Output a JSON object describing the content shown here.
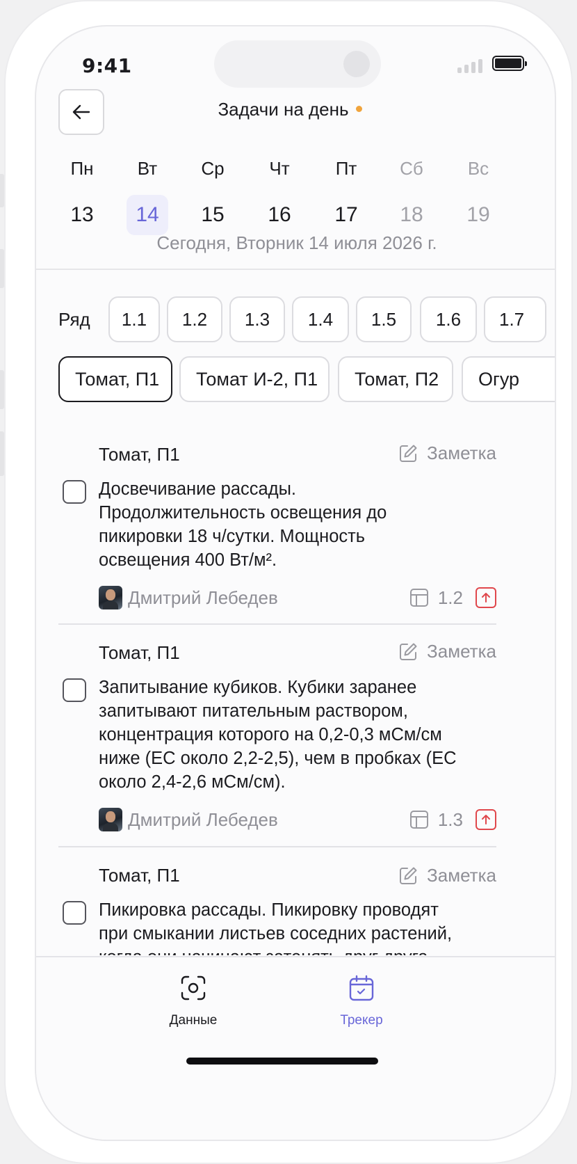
{
  "status_bar": {
    "time": "9:41"
  },
  "header": {
    "title": "Задачи на день",
    "accent_color": "#f0a43c"
  },
  "week": {
    "days": [
      {
        "name": "Пн",
        "date": "13",
        "state": "normal"
      },
      {
        "name": "Вт",
        "date": "14",
        "state": "selected"
      },
      {
        "name": "Ср",
        "date": "15",
        "state": "normal"
      },
      {
        "name": "Чт",
        "date": "16",
        "state": "normal"
      },
      {
        "name": "Пт",
        "date": "17",
        "state": "normal"
      },
      {
        "name": "Сб",
        "date": "18",
        "state": "weekend"
      },
      {
        "name": "Вс",
        "date": "19",
        "state": "weekend"
      }
    ],
    "today_text": "Сегодня, Вторник 14 июля 2026 г."
  },
  "rows": {
    "label": "Ряд",
    "items": [
      "1.1",
      "1.2",
      "1.3",
      "1.4",
      "1.5",
      "1.6",
      "1.7"
    ]
  },
  "crops": {
    "items": [
      "Томат, П1",
      "Томат И-2, П1",
      "Томат, П2",
      "Огур"
    ],
    "active": "Томат, П1"
  },
  "note_label": "Заметка",
  "tasks": [
    {
      "crop": "Томат, П1",
      "lines": [
        "Досвечивание рассады.",
        "Продолжительность освещения до",
        "пикировки 18 ч/сутки. Мощность",
        "освещения 400 Вт/м²."
      ],
      "author": "Дмитрий Лебедев",
      "bed": "1.2",
      "checked": false
    },
    {
      "crop": "Томат, П1",
      "lines": [
        "Запитывание кубиков. Кубики заранее",
        "запитывают питательным раствором,",
        "концентрация которого на 0,2-0,3 мСм/см",
        "ниже (ЕС около 2,2-2,5), чем в пробках (ЕС",
        "около 2,4-2,6 мСм/см)."
      ],
      "author": "Дмитрий Лебедев",
      "bed": "1.3",
      "checked": false
    },
    {
      "crop": "Томат, П1",
      "lines": [
        "Пикировка рассады. Пикировку проводят",
        "при смыкании листьев соседних растений,",
        "когда они начинают затенять друг друга."
      ],
      "checked": false
    }
  ],
  "tabbar": {
    "tabs": [
      {
        "label": "Данные",
        "icon": "scan-icon",
        "active": false
      },
      {
        "label": "Трекер",
        "icon": "calendar-check-icon",
        "active": true
      }
    ],
    "active_color": "#6866d8"
  },
  "colors": {
    "priority": "#e0474c",
    "selected_day_bg": "#eeeefb"
  }
}
